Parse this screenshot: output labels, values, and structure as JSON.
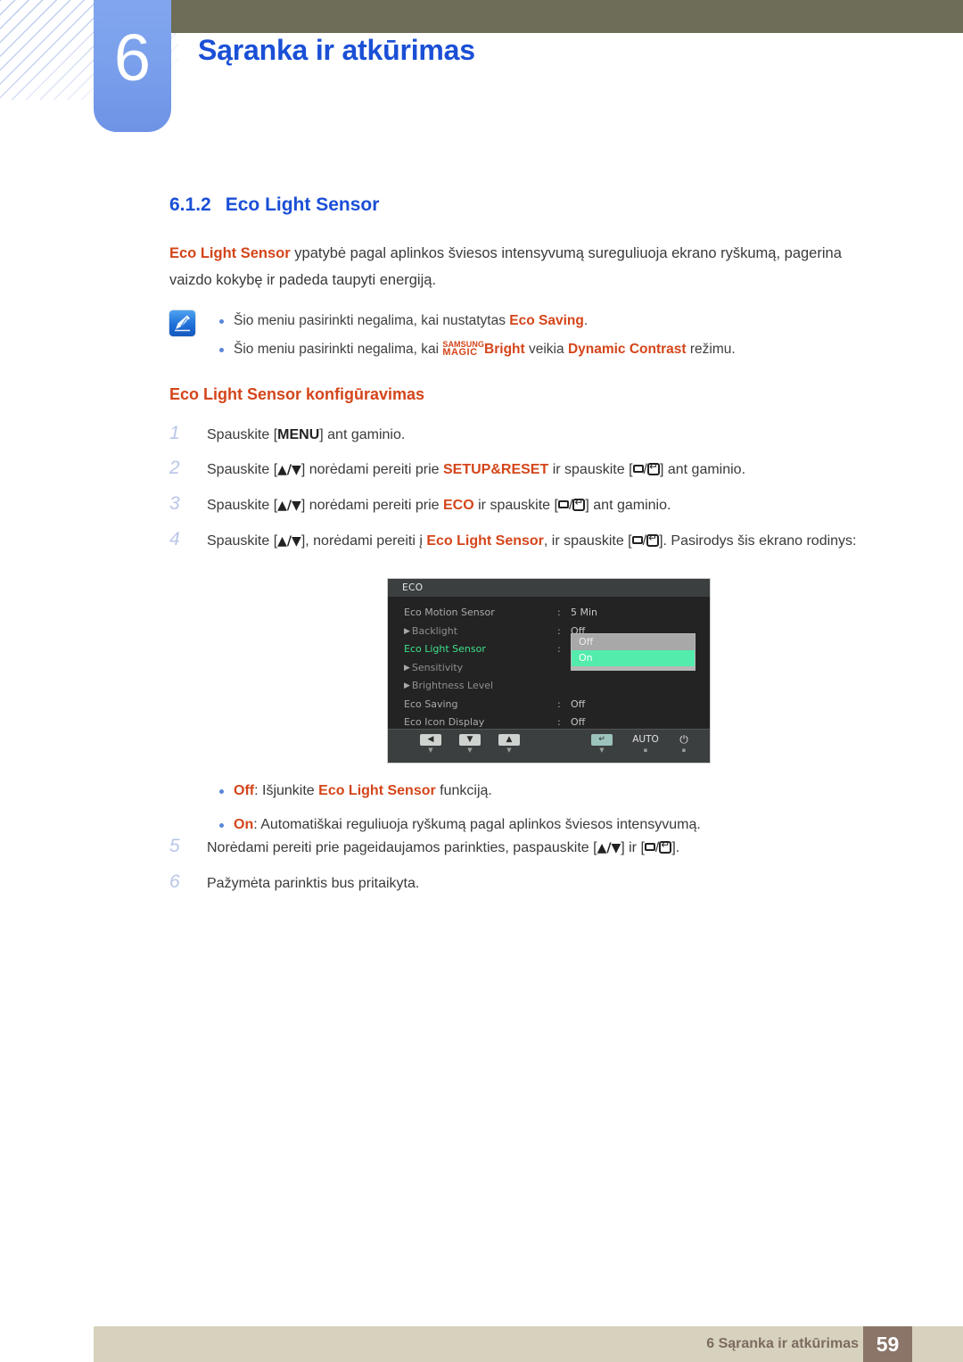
{
  "header": {
    "chapter_number": "6",
    "chapter_title": "Sąranka ir atkūrimas"
  },
  "section": {
    "number": "6.1.2",
    "title": "Eco Light Sensor",
    "intro_lead": "Eco Light Sensor",
    "intro_rest": " ypatybė pagal aplinkos šviesos intensyvumą sureguliuoja ekrano ryškumą, pagerina vaizdo kokybę ir padeda taupyti energiją.",
    "sub_heading": "Eco Light Sensor konfigūravimas"
  },
  "note": {
    "icon": "note-pen-icon",
    "items": [
      {
        "text_1": "Šio meniu pasirinkti negalima, kai nustatytas ",
        "hl_1": "Eco Saving",
        "text_2": "."
      },
      {
        "text_1": "Šio meniu pasirinkti negalima, kai ",
        "magic_top": "SAMSUNG",
        "magic_bottom": "MAGIC",
        "hl_1": "Bright",
        "text_2": " veikia ",
        "hl_2": "Dynamic Contrast",
        "text_3": " režimu."
      }
    ]
  },
  "steps": [
    {
      "number": "1",
      "p1": "Spauskite [",
      "kbd1": "MENU",
      "p2": "] ant gaminio."
    },
    {
      "number": "2",
      "p1": "Spauskite [",
      "kbd1": "▲/▼",
      "p2": "] norėdami pereiti prie ",
      "hl": "SETUP&RESET",
      "p3": " ir spauskite [",
      "p4": "] ant gaminio."
    },
    {
      "number": "3",
      "p1": "Spauskite [",
      "kbd1": "▲/▼",
      "p2": "] norėdami pereiti prie ",
      "hl": "ECO",
      "p3": " ir spauskite [",
      "p4": "] ant gaminio."
    },
    {
      "number": "4",
      "p1": "Spauskite [",
      "kbd1": "▲/▼",
      "p2": "], norėdami pereiti į ",
      "hl": "Eco Light Sensor",
      "p3": ", ir spauskite [",
      "p4": "]. Pasirodys šis ekrano rodinys:"
    }
  ],
  "steps_after": [
    {
      "number": "5",
      "p1": "Norėdami pereiti prie pageidaujamos parinkties, paspauskite [",
      "kbd1": "▲/▼",
      "p2": "] ir [",
      "p3": "]."
    },
    {
      "number": "6",
      "p1": "Pažymėta parinktis bus pritaikyta."
    }
  ],
  "osd": {
    "title": "ECO",
    "rows": [
      {
        "label": "Eco Motion Sensor",
        "sub": false,
        "selected": false,
        "colon": ":",
        "value": "5 Min"
      },
      {
        "label": "Backlight",
        "sub": true,
        "selected": false,
        "colon": ":",
        "value": "Off"
      },
      {
        "label": "Eco Light Sensor",
        "sub": false,
        "selected": true,
        "colon": ":",
        "value": ""
      },
      {
        "label": "Sensitivity",
        "sub": true,
        "selected": false,
        "colon": "",
        "value": ""
      },
      {
        "label": "Brightness Level",
        "sub": true,
        "selected": false,
        "colon": "",
        "value": ""
      },
      {
        "label": "Eco Saving",
        "sub": false,
        "selected": false,
        "colon": ":",
        "value": "Off"
      },
      {
        "label": "Eco Icon Display",
        "sub": false,
        "selected": false,
        "colon": ":",
        "value": "Off"
      }
    ],
    "dropdown": {
      "option_off": "Off",
      "option_on": "On",
      "selected": "On"
    },
    "footer_buttons": [
      {
        "icon": "arrow-left-icon",
        "glyph": "◀",
        "type": "key",
        "tick": "▼"
      },
      {
        "icon": "arrow-down-icon",
        "glyph": "▼",
        "type": "key",
        "tick": "▼"
      },
      {
        "icon": "arrow-up-icon",
        "glyph": "▲",
        "type": "key",
        "tick": "▼"
      },
      {
        "icon": "enter-icon",
        "glyph": "↵",
        "type": "key-teal",
        "tick": "▼"
      },
      {
        "icon": "auto-label",
        "glyph": "AUTO",
        "type": "text",
        "tick": "▪"
      },
      {
        "icon": "power-icon",
        "glyph": "⏻",
        "type": "power",
        "tick": "▪"
      }
    ],
    "colors": {
      "background": "#232323",
      "title_bar": "#3b3f3f",
      "selected_label": "#3fe08a",
      "highlight_on": "#53ecad",
      "option_off_bg": "#a8a8a8"
    }
  },
  "option_bullets": [
    {
      "hl_1": "Off",
      "text_1": ": Išjunkite ",
      "hl_2": "Eco Light Sensor",
      "text_2": " funkciją."
    },
    {
      "hl_1": "On",
      "text_1": ": Automatiškai reguliuoja ryškumą pagal aplinkos šviesos intensyvumą."
    }
  ],
  "footer": {
    "text": "6 Sąranka ir atkūrimas",
    "page_number": "59"
  },
  "colors": {
    "chapter_blue": "#1a4fd6",
    "accent_red": "#d4451a",
    "olive": "#6e6d58",
    "badge_blue": "#7ba0ec",
    "footer_bar": "#d7d2bd",
    "footer_page_box": "#8a7568"
  }
}
